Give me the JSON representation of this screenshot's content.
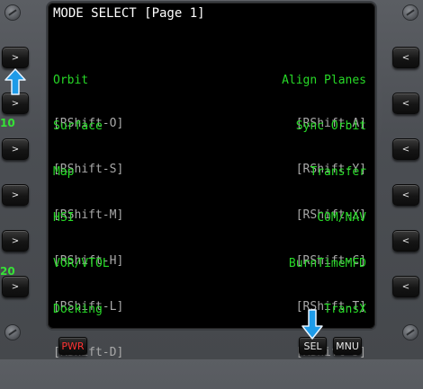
{
  "screen": {
    "title": "MODE SELECT [Page 1]",
    "left_entries": [
      {
        "name": "Orbit",
        "key": "[RShift-O]"
      },
      {
        "name": "Surface",
        "key": "[RShift-S]"
      },
      {
        "name": "Map",
        "key": "[RShift-M]"
      },
      {
        "name": "HSI",
        "key": "[RShift-H]"
      },
      {
        "name": "VOR/VTOL",
        "key": "[RShift-L]"
      },
      {
        "name": "Docking",
        "key": "[RShift-D]"
      }
    ],
    "right_entries": [
      {
        "name": "Align Planes",
        "key": "[RShift-A]"
      },
      {
        "name": "Sync Orbit",
        "key": "[RShift-Y]"
      },
      {
        "name": "Transfer",
        "key": "[RShift-X]"
      },
      {
        "name": "COM/NAV",
        "key": "[RShift-C]"
      },
      {
        "name": "BurnTimeMFD",
        "key": "[RShift-T]"
      },
      {
        "name": "TransX",
        "key": "[RShift-J]"
      }
    ]
  },
  "side_buttons": {
    "left_glyph": ">",
    "right_glyph": "<"
  },
  "bezel_labels": {
    "scale_10": "10",
    "scale_20": "20"
  },
  "bottom_buttons": {
    "pwr": "PWR",
    "sel": "SEL",
    "mnu": "MNU"
  },
  "colors": {
    "menu_text": "#27d927",
    "shortcut_text": "#a8a8a8",
    "title_text": "#ffffff",
    "pwr_text": "#ff3333",
    "highlight_arrow": "#1e9be8"
  }
}
